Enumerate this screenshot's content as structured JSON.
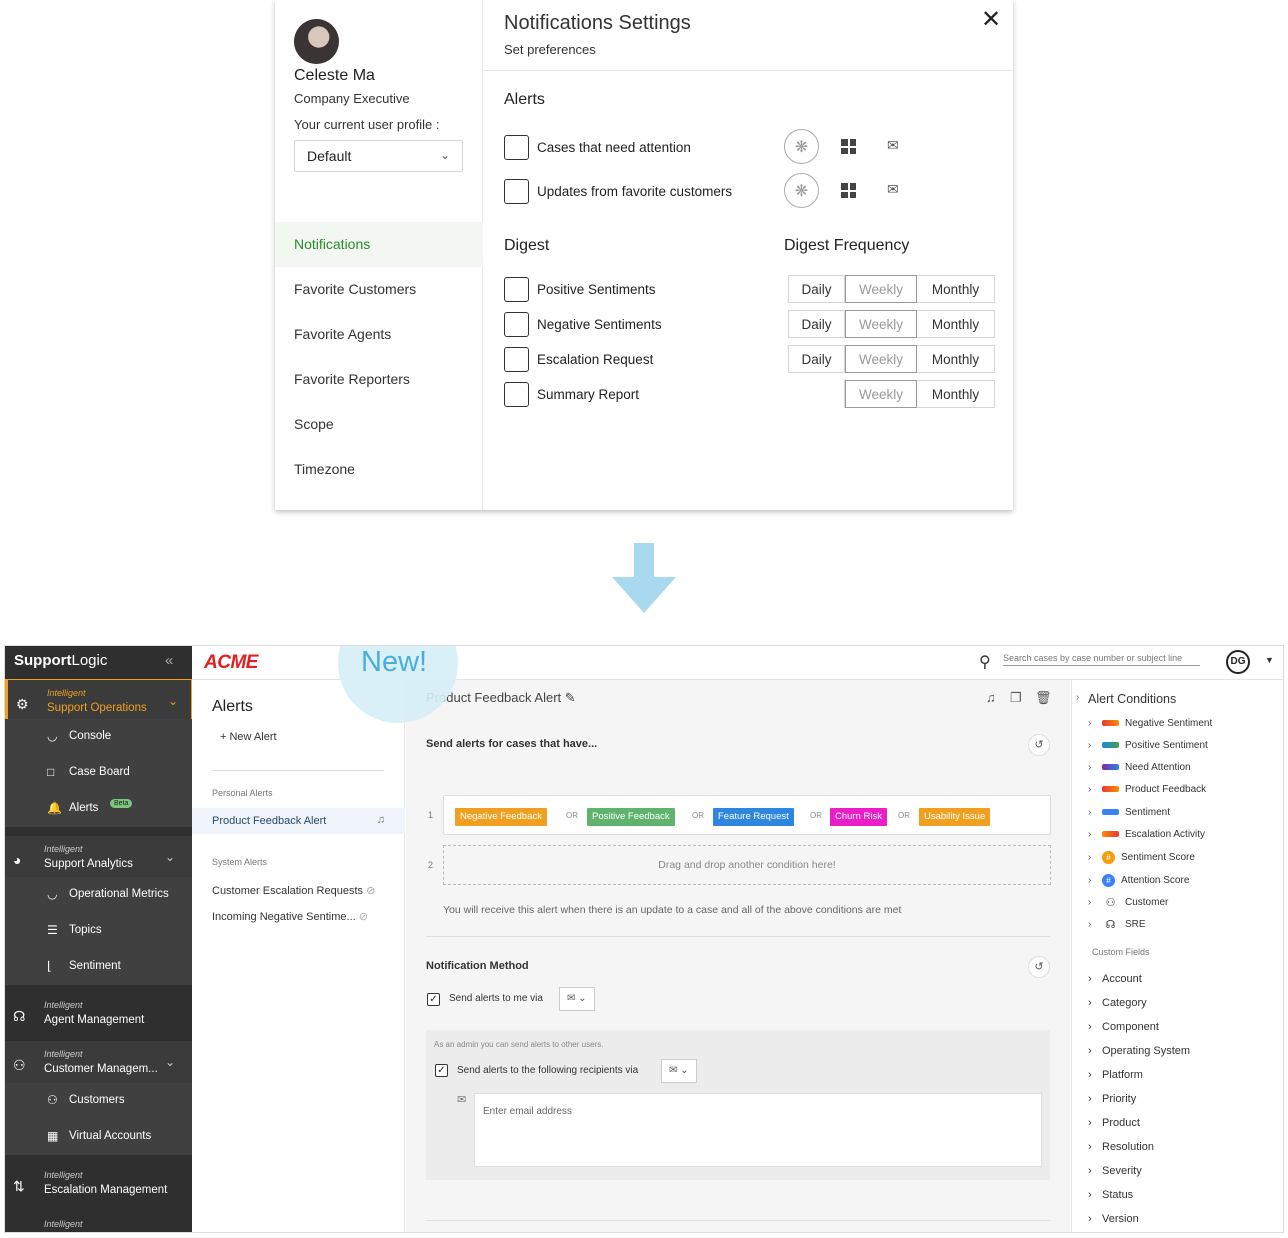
{
  "modal": {
    "user_name": "Celeste Ma",
    "user_role": "Company Executive",
    "profile_label": "Your current user profile :",
    "profile_value": "Default",
    "nav": [
      "Notifications",
      "Favorite Customers",
      "Favorite Agents",
      "Favorite Reporters",
      "Scope",
      "Timezone"
    ],
    "title": "Notifications Settings",
    "subtitle": "Set preferences",
    "alerts_heading": "Alerts",
    "alerts": [
      "Cases that need attention",
      "Updates from favorite customers"
    ],
    "digest_heading": "Digest",
    "frequency_heading": "Digest Frequency",
    "digest": [
      {
        "label": "Positive Sentiments",
        "options": [
          "Daily",
          "Weekly",
          "Monthly"
        ],
        "selected": "Weekly"
      },
      {
        "label": "Negative Sentiments",
        "options": [
          "Daily",
          "Weekly",
          "Monthly"
        ],
        "selected": "Weekly"
      },
      {
        "label": "Escalation Request",
        "options": [
          "Daily",
          "Weekly",
          "Monthly"
        ],
        "selected": "Weekly"
      },
      {
        "label": "Summary Report",
        "options": [
          "Weekly",
          "Monthly"
        ],
        "selected": "Weekly"
      }
    ],
    "close_glyph": "✕"
  },
  "app": {
    "brand_a": "Support",
    "brand_b": "Logic",
    "customer_logo": "ACME",
    "new_badge": "New!",
    "search_placeholder": "Search cases by case number or subject line",
    "user_initials": "DG",
    "sidebar": {
      "ops": {
        "small": "Intelligent",
        "main": "Support Operations"
      },
      "ops_items": [
        "Console",
        "Case Board",
        "Alerts"
      ],
      "beta": "Beta",
      "analytics": {
        "small": "Intelligent",
        "main": "Support Analytics"
      },
      "analytics_items": [
        "Operational Metrics",
        "Topics",
        "Sentiment"
      ],
      "agent": {
        "small": "Intelligent",
        "main": "Agent Management"
      },
      "customer": {
        "small": "Intelligent",
        "main": "Customer Managem..."
      },
      "customer_items": [
        "Customers",
        "Virtual Accounts"
      ],
      "escalation": {
        "small": "Intelligent",
        "main": "Escalation Management"
      },
      "last": {
        "small": "Intelligent"
      }
    },
    "alerts_panel": {
      "title": "Alerts",
      "new_alert": "+ New Alert",
      "personal_label": "Personal Alerts",
      "personal": [
        "Product Feedback Alert"
      ],
      "system_label": "System Alerts",
      "system": [
        "Customer Escalation Requests",
        "Incoming Negative Sentime..."
      ]
    },
    "editor": {
      "title": "Product Feedback Alert",
      "send_heading": "Send alerts for cases that have...",
      "row1": "1",
      "row2": "2",
      "tags": [
        {
          "label": "Negative Feedback",
          "color": "#f0a020"
        },
        {
          "label": "Positive Feedback",
          "color": "#5fb36f"
        },
        {
          "label": "Feature Request",
          "color": "#2e86de"
        },
        {
          "label": "Churn Risk",
          "color": "#e91ec7"
        },
        {
          "label": "Usability Issue",
          "color": "#f0a020"
        }
      ],
      "or": "OR",
      "drop": "Drag and drop another condition here!",
      "note": "You will receive this alert when there is an update to a case and all of the above conditions are met",
      "notif_heading": "Notification Method",
      "send_me": "Send alerts to me via",
      "admin_note": "As an admin you can send alerts to other users.",
      "send_recipients": "Send alerts to the following recipients via",
      "email_placeholder": "Enter email address"
    },
    "conditions": {
      "title": "Alert Conditions",
      "items": [
        {
          "label": "Negative Sentiment",
          "kind": "bar",
          "color": "linear-gradient(90deg,#e53935,#fb8c00)"
        },
        {
          "label": "Positive Sentiment",
          "kind": "bar",
          "color": "linear-gradient(90deg,#1e88e5,#43a047)"
        },
        {
          "label": "Need Attention",
          "kind": "bar",
          "color": "linear-gradient(90deg,#8e24aa,#1e88e5)"
        },
        {
          "label": "Product Feedback",
          "kind": "bar",
          "color": "linear-gradient(90deg,#e53935,#fb8c00)"
        },
        {
          "label": "Sentiment",
          "kind": "bar",
          "color": "#3b82f6"
        },
        {
          "label": "Escalation Activity",
          "kind": "bar",
          "color": "linear-gradient(90deg,#fb8c00,#e53935)"
        },
        {
          "label": "Sentiment Score",
          "kind": "circle",
          "color": "#f59e0b"
        },
        {
          "label": "Attention Score",
          "kind": "circle",
          "color": "#3b82f6"
        },
        {
          "label": "Customer",
          "kind": "person"
        },
        {
          "label": "SRE",
          "kind": "headset"
        }
      ],
      "custom_label": "Custom Fields",
      "fields": [
        "Account",
        "Category",
        "Component",
        "Operating System",
        "Platform",
        "Priority",
        "Product",
        "Resolution",
        "Severity",
        "Status",
        "Version"
      ]
    }
  }
}
